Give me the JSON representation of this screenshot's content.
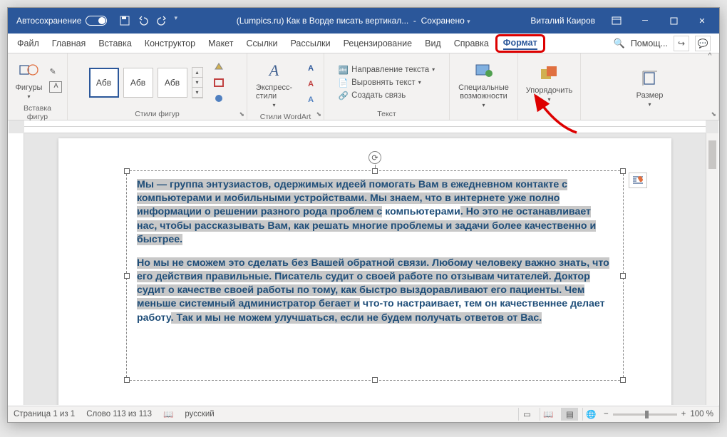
{
  "titlebar": {
    "autosave": "Автосохранение",
    "doctitle": "(Lumpics.ru) Как в Ворде писать вертикал...",
    "saved": "Сохранено",
    "user": "Виталий Каиров"
  },
  "tabs": {
    "file": "Файл",
    "home": "Главная",
    "insert": "Вставка",
    "design": "Конструктор",
    "layout": "Макет",
    "references": "Ссылки",
    "mailings": "Рассылки",
    "review": "Рецензирование",
    "view": "Вид",
    "help": "Справка",
    "format": "Формат",
    "helpbtn": "Помощ..."
  },
  "ribbon": {
    "shapes": "Фигуры",
    "groupInsert": "Вставка фигур",
    "styleSample": "Абв",
    "groupStyles": "Стили фигур",
    "express": "Экспресс-стили",
    "groupWA": "Стили WordArt",
    "textDirection": "Направление текста",
    "alignText": "Выровнять текст",
    "createLink": "Создать связь",
    "groupText": "Текст",
    "accessibility": "Специальные возможности",
    "arrange": "Упорядочить",
    "size": "Размер"
  },
  "document": {
    "para1_a": "Мы — группа энтузиастов, одержимых идеей помогать Вам в ежедневном контакте с компьютерами и мобильными устройствами. Мы знаем, что в интернете уже полно информации о решении разного рода проблем с",
    "para1_b": "компьютерами",
    "para1_c": ". Но это не останавливает нас, чтобы рассказывать Вам, как решать многие проблемы и задачи более качественно и быстрее.",
    "para2_a": "Но мы не сможем это сделать без Вашей обратной связи. Любому человеку важно знать, что его действия правильные. Писатель судит о своей работе по отзывам читателей. Доктор судит о качестве своей работы по тому, как быстро выздоравливают его пациенты. Чем меньше системный администратор бегает и",
    "para2_b": "что-то настраивает, тем он качественнее делает работу",
    "para2_c": ". Так и мы не можем улучшаться, если не будем получать ответов от Вас."
  },
  "statusbar": {
    "page": "Страница 1 из 1",
    "words": "Слово 113 из 113",
    "lang": "русский",
    "zoom": "100 %"
  }
}
